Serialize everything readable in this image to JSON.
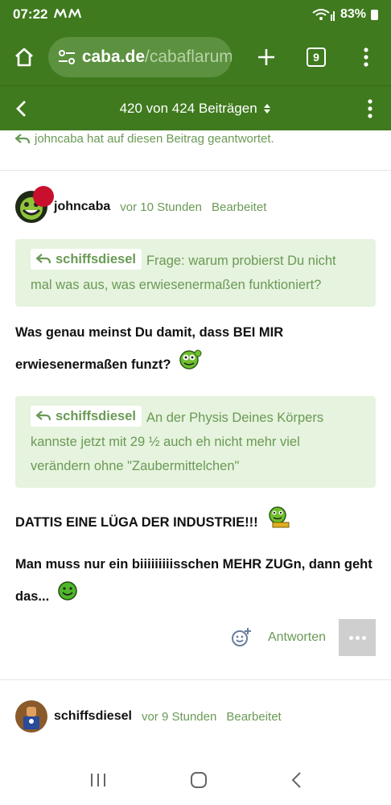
{
  "status": {
    "time": "07:22",
    "battery": "83%"
  },
  "browser": {
    "domain": "caba.de",
    "path": "/cabaflarum.",
    "tab_count": "9"
  },
  "thread": {
    "counter": "420 von 424 Beiträgen"
  },
  "replied_notice": "johncaba hat auf diesen Beitrag geantwortet.",
  "posts": [
    {
      "author": "johncaba",
      "time": "vor 10 Stunden",
      "edited": "Bearbeitet",
      "quote1": {
        "user": "schiffsdiesel",
        "text": "Frage: warum probierst Du nicht mal was aus, was erwiesenermaßen funktioniert?"
      },
      "text1a": "Was genau meinst Du damit, dass BEI MIR",
      "text1b": "erwiesenermaßen funzt?",
      "quote2": {
        "user": "schiffsdiesel",
        "text": "An der Physis Deines Körpers kannste jetzt mit 29 ½ auch eh nicht mehr viel verändern ohne \"Zaubermittelchen\""
      },
      "text2": "DATTIS EINE LÜGA DER INDUSTRIE!!!",
      "text3a": "Man muss nur ein biiiiiiiiisschen MEHR ZUGn, dann geht",
      "text3b": "das...",
      "reply_label": "Antworten"
    },
    {
      "author": "schiffsdiesel",
      "time": "vor 9 Stunden",
      "edited": "Bearbeitet"
    }
  ],
  "colors": {
    "header": "#3f7a1e",
    "accent": "#6a9a55",
    "quote_bg": "#e6f3de"
  },
  "icons": [
    "home-icon",
    "tune-icon",
    "plus-icon",
    "tabs-icon",
    "menu-dots-icon",
    "back-chevron-icon",
    "sort-arrows-icon",
    "reply-arrow-icon",
    "add-reaction-icon",
    "recent-apps-icon",
    "home-circle-icon",
    "nav-back-icon"
  ]
}
